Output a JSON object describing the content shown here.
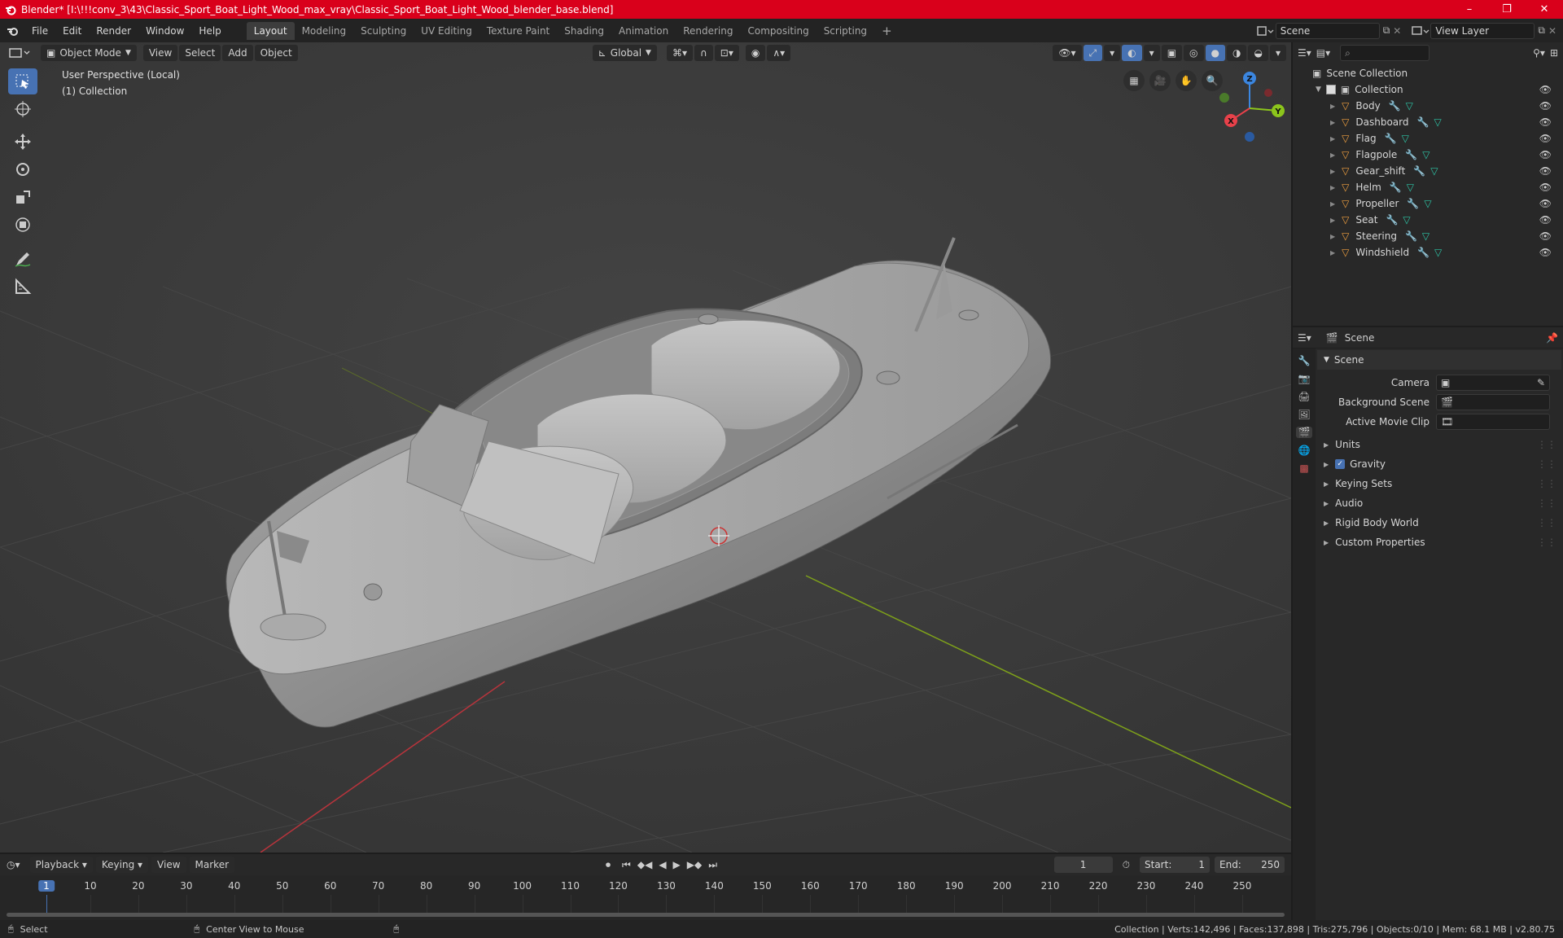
{
  "window": {
    "title": "Blender* [I:\\!!!conv_3\\43\\Classic_Sport_Boat_Light_Wood_max_vray\\Classic_Sport_Boat_Light_Wood_blender_base.blend]",
    "minimize": "–",
    "maximize": "❐",
    "close": "✕"
  },
  "menu": [
    "File",
    "Edit",
    "Render",
    "Window",
    "Help"
  ],
  "workspaces": {
    "tabs": [
      "Layout",
      "Modeling",
      "Sculpting",
      "UV Editing",
      "Texture Paint",
      "Shading",
      "Animation",
      "Rendering",
      "Compositing",
      "Scripting"
    ],
    "active": "Layout",
    "add": "+"
  },
  "scene_selector": {
    "value": "Scene"
  },
  "view_layer": {
    "value": "View Layer"
  },
  "viewport": {
    "mode": "Object Mode",
    "menus": [
      "View",
      "Select",
      "Add",
      "Object"
    ],
    "transform_orientation": "Global",
    "perspective_label": "User Perspective (Local)",
    "collection_label": "(1) Collection",
    "gizmo_axes": {
      "x": "X",
      "y": "Y",
      "z": "Z"
    }
  },
  "outliner": {
    "search_placeholder": "",
    "root": "Scene Collection",
    "collection": "Collection",
    "objects": [
      "Body",
      "Dashboard",
      "Flag",
      "Flagpole",
      "Gear_shift",
      "Helm",
      "Propeller",
      "Seat",
      "Steering",
      "Windshield"
    ]
  },
  "properties": {
    "context": "Scene",
    "panel_title": "Scene",
    "fields": [
      {
        "label": "Camera",
        "value": ""
      },
      {
        "label": "Background Scene",
        "value": ""
      },
      {
        "label": "Active Movie Clip",
        "value": ""
      }
    ],
    "subpanels": [
      "Units",
      "Gravity",
      "Keying Sets",
      "Audio",
      "Rigid Body World",
      "Custom Properties"
    ],
    "gravity_checked": true
  },
  "timeline": {
    "menus": [
      "Playback",
      "Keying",
      "View",
      "Marker"
    ],
    "current_frame": "1",
    "start_label": "Start:",
    "start": "1",
    "end_label": "End:",
    "end": "250",
    "ticks": [
      "1",
      "10",
      "20",
      "30",
      "40",
      "50",
      "60",
      "70",
      "80",
      "90",
      "100",
      "110",
      "120",
      "130",
      "140",
      "150",
      "160",
      "170",
      "180",
      "190",
      "200",
      "210",
      "220",
      "230",
      "240",
      "250"
    ]
  },
  "statusbar": {
    "left_action": "Select",
    "middle_action": "Center View to Mouse",
    "stats": "Collection | Verts:142,496 | Faces:137,898 | Tris:275,796 | Objects:0/10 | Mem: 68.1 MB | v2.80.75"
  },
  "colors": {
    "title_bar": "#d9001b",
    "accent": "#4772b3",
    "object_icon": "#f0a040",
    "modifier_icon": "#6a9fe0",
    "mesh_icon": "#2ec4a6",
    "x_axis": "#e8414a",
    "y_axis": "#8cc51c",
    "z_axis": "#3b86e0"
  }
}
